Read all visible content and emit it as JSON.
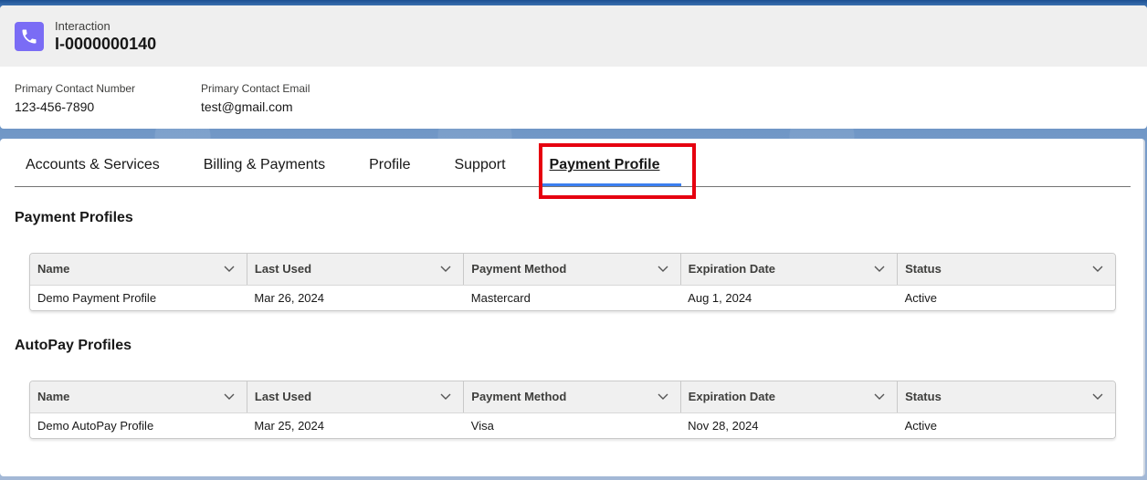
{
  "header": {
    "record_type": "Interaction",
    "record_name": "I-0000000140",
    "icon": "phone-icon",
    "icon_color": "#7a6cf5",
    "fields": [
      {
        "label": "Primary Contact Number",
        "value": "123-456-7890"
      },
      {
        "label": "Primary Contact Email",
        "value": "test@gmail.com"
      }
    ]
  },
  "tabs": [
    {
      "label": "Accounts & Services",
      "active": false
    },
    {
      "label": "Billing & Payments",
      "active": false
    },
    {
      "label": "Profile",
      "active": false
    },
    {
      "label": "Support",
      "active": false
    },
    {
      "label": "Payment Profile",
      "active": true
    }
  ],
  "accent_color": "#3b7ff0",
  "highlight_color": "#e6000f",
  "sections": [
    {
      "title": "Payment Profiles",
      "columns": [
        "Name",
        "Last Used",
        "Payment Method",
        "Expiration Date",
        "Status"
      ],
      "rows": [
        [
          "Demo Payment Profile",
          "Mar 26, 2024",
          "Mastercard",
          "Aug 1, 2024",
          "Active"
        ]
      ]
    },
    {
      "title": "AutoPay Profiles",
      "columns": [
        "Name",
        "Last Used",
        "Payment Method",
        "Expiration Date",
        "Status"
      ],
      "rows": [
        [
          "Demo AutoPay Profile",
          "Mar 25, 2024",
          "Visa",
          "Nov 28, 2024",
          "Active"
        ]
      ]
    }
  ]
}
